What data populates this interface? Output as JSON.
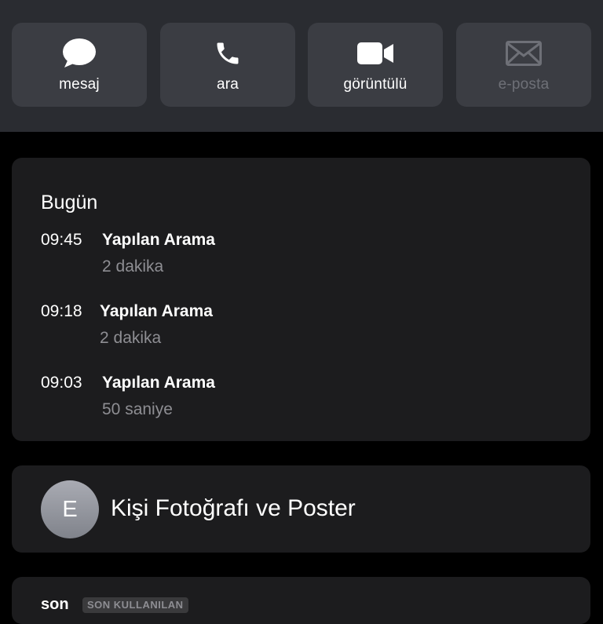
{
  "actions": [
    {
      "label": "mesaj",
      "icon": "message-icon",
      "enabled": true
    },
    {
      "label": "ara",
      "icon": "phone-icon",
      "enabled": true
    },
    {
      "label": "görüntülü",
      "icon": "video-icon",
      "enabled": true
    },
    {
      "label": "e-posta",
      "icon": "mail-icon",
      "enabled": false
    }
  ],
  "calls": {
    "title": "Bugün",
    "items": [
      {
        "time": "09:45",
        "type": "Yapılan Arama",
        "duration": "2 dakika"
      },
      {
        "time": "09:18",
        "type": "Yapılan Arama",
        "duration": "2 dakika"
      },
      {
        "time": "09:03",
        "type": "Yapılan Arama",
        "duration": "50 saniye"
      }
    ]
  },
  "contact_poster": {
    "avatar_initial": "E",
    "label": "Kişi Fotoğrafı ve Poster"
  },
  "recent": {
    "sim": "son",
    "badge": "SON KULLANILAN"
  },
  "colors": {
    "header_bg": "#2a2c31",
    "button_bg": "#3b3d43",
    "card_bg": "#1c1c1e",
    "secondary_text": "#8e8e93",
    "disabled_text": "#6e7077"
  }
}
